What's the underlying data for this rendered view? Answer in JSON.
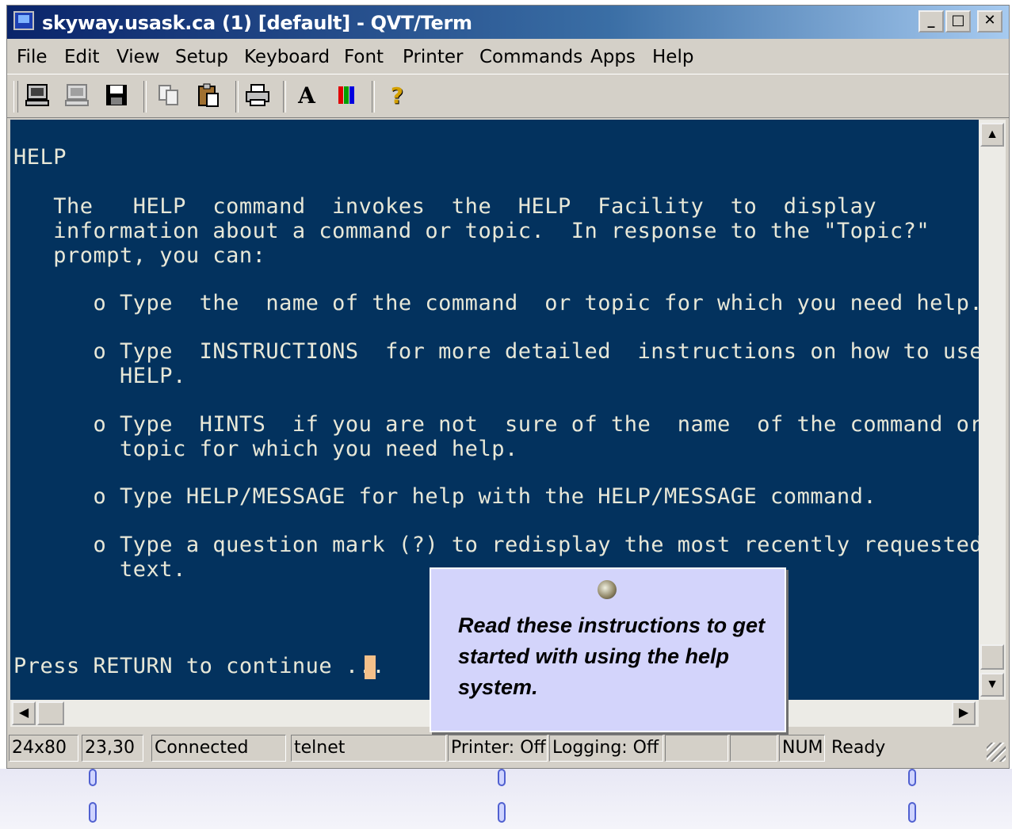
{
  "window": {
    "title": "skyway.usask.ca (1) [default] - QVT/Term",
    "buttons": {
      "minimize": "_",
      "maximize": "□",
      "close": "✕"
    }
  },
  "menu": [
    "File",
    "Edit",
    "View",
    "Setup",
    "Keyboard",
    "Font",
    "Printer",
    "Commands",
    "Apps",
    "Help"
  ],
  "toolbar": {
    "icons": [
      "terminal-icon",
      "disconnect-icon",
      "save-icon",
      "copy-icon",
      "paste-icon",
      "print-icon",
      "font-icon",
      "color-icon",
      "help-icon"
    ],
    "font_glyph": "A",
    "help_glyph": "?"
  },
  "terminal": {
    "lines": [
      "HELP",
      "",
      "   The   HELP  command  invokes  the  HELP  Facility  to  display",
      "   information about a command or topic.  In response to the \"Topic?\"",
      "   prompt, you can:",
      "",
      "      o Type  the  name of the command  or topic for which you need help.",
      "",
      "      o Type  INSTRUCTIONS  for more detailed  instructions on how to use",
      "        HELP.",
      "",
      "      o Type  HINTS  if you are not  sure of the  name  of the command or",
      "        topic for which you need help.",
      "",
      "      o Type HELP/MESSAGE for help with the HELP/MESSAGE command.",
      "",
      "      o Type a question mark (?) to redisplay the most recently requested",
      "        text.",
      "",
      "",
      "",
      "Press RETURN to continue ... "
    ],
    "cursor_color": "#f4c08a",
    "background": "#03325e"
  },
  "statusbar": {
    "size": "24x80",
    "position": "23,30",
    "connection": "Connected",
    "protocol": "telnet",
    "printer": "Printer: Off",
    "logging": "Logging: Off",
    "blank1": "",
    "blank2": "",
    "num": "NUM",
    "state": "Ready"
  },
  "callout": {
    "text": "Read these instructions to get started with using the help system."
  }
}
